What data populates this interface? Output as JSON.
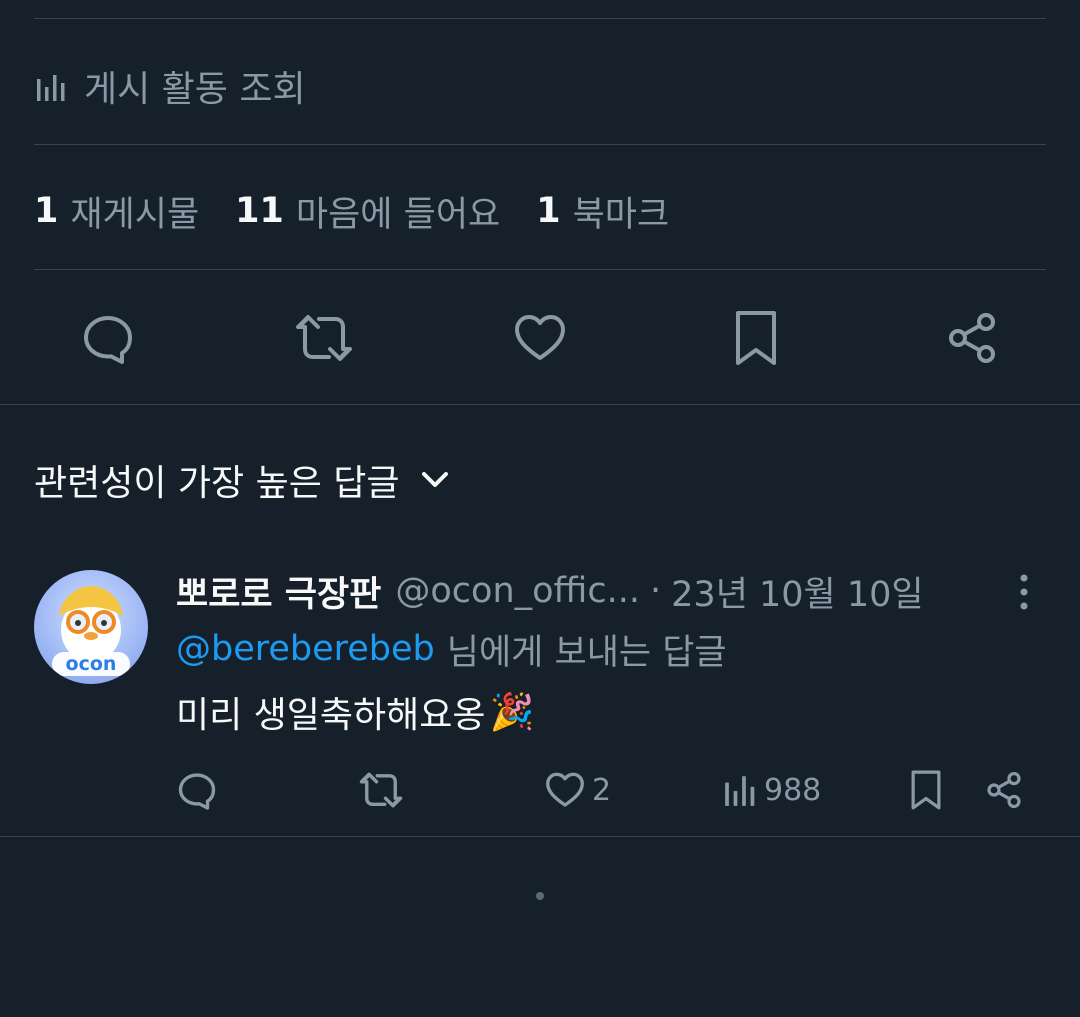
{
  "analytics": {
    "label": "게시 활동 조회",
    "icon": "analytics-bars-icon"
  },
  "stats": [
    {
      "num": "1",
      "label": "재게시물"
    },
    {
      "num": "11",
      "label": "마음에 들어요"
    },
    {
      "num": "1",
      "label": "북마크"
    }
  ],
  "main_actions": [
    "reply-icon",
    "repost-icon",
    "like-icon",
    "bookmark-icon",
    "share-icon"
  ],
  "sort": {
    "label": "관련성이 가장 높은 답글",
    "icon": "chevron-down-icon"
  },
  "reply": {
    "name": "뽀로로 극장판",
    "handle": "@ocon_offic...",
    "separator": "·",
    "date": "23년 10월 10일",
    "mention": "@bereberebeb",
    "replying_suffix": "님에게 보내는 답글",
    "text": "미리 생일축하해요옹",
    "emoji": "🎉",
    "avatar_text": "ocon",
    "likes": "2",
    "views": "988"
  },
  "colors": {
    "background": "#15202b",
    "text_secondary": "#8b98a5",
    "link": "#1d9bf0",
    "divider": "#38444d"
  }
}
